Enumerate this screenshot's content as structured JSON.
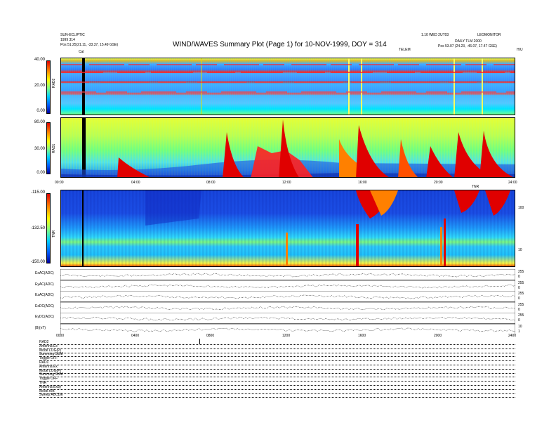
{
  "header": {
    "title": "WIND/WAVES Summary Plot (Page 1) for 10-NOV-1999, DOY = 314",
    "left_line1": "SUN-ECLIPTIC",
    "left_line2": "1999 314",
    "left_line3": "Pos 51.25(21.11, -33.37, 15.49 GSE)",
    "right_line1": "LEOMONITOR",
    "right_line2": "DAILY TLM 2000",
    "right_line3": "Pos 53.07 (24.23, -46.07, 17.47 GSE)",
    "center_right_small": "1.10 WED 2UT03",
    "tel_label": "TELEM",
    "marker_label": "Cal",
    "page_mark": "H/U"
  },
  "panels": {
    "rad2": {
      "label": "RAD2",
      "ticks": [
        "40.00",
        "20.00",
        "0.00"
      ]
    },
    "rad1": {
      "label": "RAD1",
      "ticks": [
        "80.00",
        "30.00",
        "0.00"
      ]
    },
    "tnr": {
      "label": "TNR",
      "ticks": [
        "-115.00",
        "-132.50",
        "-150.00"
      ],
      "right_ticks": [
        "100",
        "10"
      ]
    },
    "time_top": [
      "00:00",
      "04:00",
      "08:00",
      "12:00",
      "16:00",
      "20:00",
      "24:00"
    ],
    "time_bottom": [
      "0000",
      "0400",
      "0800",
      "1200",
      "1600",
      "2000",
      "2400"
    ],
    "tnr_side_label": "TNR"
  },
  "traces": [
    {
      "label": "ExAC(ADC)"
    },
    {
      "label": "EyAC(ADC)"
    },
    {
      "label": "EzAC(ADC)"
    },
    {
      "label": "ExDC(ADC)"
    },
    {
      "label": "EyDC(ADC)"
    },
    {
      "label": "|B|(nT)"
    }
  ],
  "trace_right_ticks": [
    "255",
    "0",
    "255",
    "0",
    "255",
    "0",
    "255",
    "0",
    "255",
    "0",
    "10",
    "1"
  ],
  "footer": {
    "rad2": [
      "RAD2",
      "Antenna Ex",
      "Mode LOG(P)",
      "Summing SUM",
      "Toggle OFF"
    ],
    "rad1": [
      "RAD1",
      "Antenna Ex",
      "Mode LOG(P)",
      "Summing SUM",
      "Toggle OFF"
    ],
    "tnr": [
      "TNR",
      "Antenna Exdy",
      "Mode A/B",
      "Sweep ABCDE"
    ]
  },
  "chart_data": [
    {
      "type": "heatmap",
      "title": "",
      "ylabel": "RAD2",
      "ylim": [
        0,
        40
      ],
      "xlabel": "",
      "xlim": [
        "00:00",
        "24:00"
      ]
    },
    {
      "type": "heatmap",
      "title": "",
      "ylabel": "RAD1",
      "ylim": [
        0,
        80
      ],
      "xlabel": "",
      "xlim": [
        "00:00",
        "24:00"
      ]
    },
    {
      "type": "heatmap",
      "title": "",
      "ylabel": "TNR",
      "ylim": [
        -150,
        -115
      ],
      "xlabel": "",
      "xlim": [
        "00:00",
        "24:00"
      ]
    },
    {
      "type": "line",
      "series": [
        {
          "name": "ExAC(ADC)"
        },
        {
          "name": "EyAC(ADC)"
        },
        {
          "name": "EzAC(ADC)"
        },
        {
          "name": "ExDC(ADC)"
        },
        {
          "name": "EyDC(ADC)"
        },
        {
          "name": "|B|(nT)"
        }
      ]
    }
  ],
  "colors": {
    "red": "#e00000",
    "orange": "#ff8000",
    "yellow": "#ffff00",
    "green": "#80ff80",
    "cyan": "#00d0ff",
    "blue": "#0060ff",
    "navy": "#0000a0"
  }
}
